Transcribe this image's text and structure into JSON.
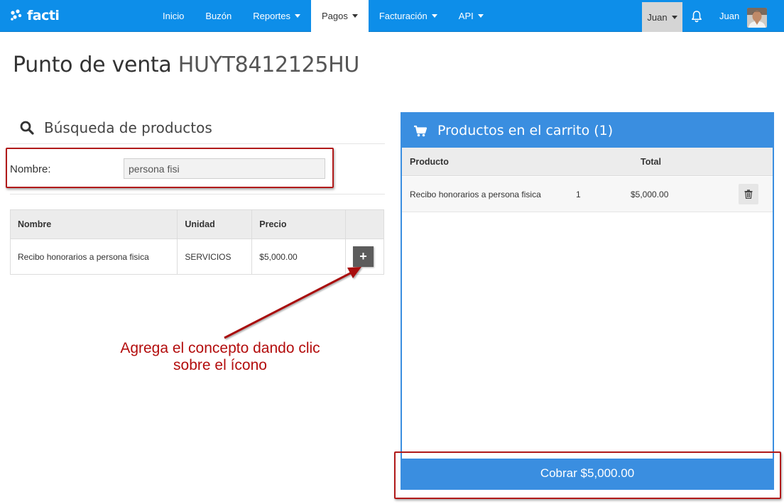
{
  "brand": {
    "name": "facti"
  },
  "nav": {
    "items": [
      {
        "label": "Inicio",
        "has_caret": false,
        "active": false
      },
      {
        "label": "Buzón",
        "has_caret": false,
        "active": false
      },
      {
        "label": "Reportes",
        "has_caret": true,
        "active": false
      },
      {
        "label": "Pagos",
        "has_caret": true,
        "active": true
      },
      {
        "label": "Facturación",
        "has_caret": true,
        "active": false
      },
      {
        "label": "API",
        "has_caret": true,
        "active": false
      }
    ],
    "user_dropdown": "Juan",
    "user_name": "Juan"
  },
  "page": {
    "title": "Punto de venta",
    "rfc": "HUYT8412125HU"
  },
  "search": {
    "heading": "Búsqueda de productos",
    "field_label": "Nombre:",
    "field_value": "persona fisi"
  },
  "products_table": {
    "headers": [
      "Nombre",
      "Unidad",
      "Precio",
      ""
    ],
    "rows": [
      {
        "nombre": "Recibo honorarios a persona fisica",
        "unidad": "SERVICIOS",
        "precio": "$5,000.00"
      }
    ]
  },
  "annotation": {
    "line1": "Agrega el concepto dando clic",
    "line2": "sobre el ícono"
  },
  "cart": {
    "heading": "Productos en el carrito (1)",
    "col_producto": "Producto",
    "col_total": "Total",
    "rows": [
      {
        "producto": "Recibo honorarios a persona fisica",
        "cantidad": "1",
        "total": "$5,000.00"
      }
    ],
    "charge_button": "Cobrar $5,000.00"
  },
  "colors": {
    "navbar": "#0d8ee9",
    "cart_accent": "#3a8ee0",
    "annotation_red": "#b11a1a"
  }
}
